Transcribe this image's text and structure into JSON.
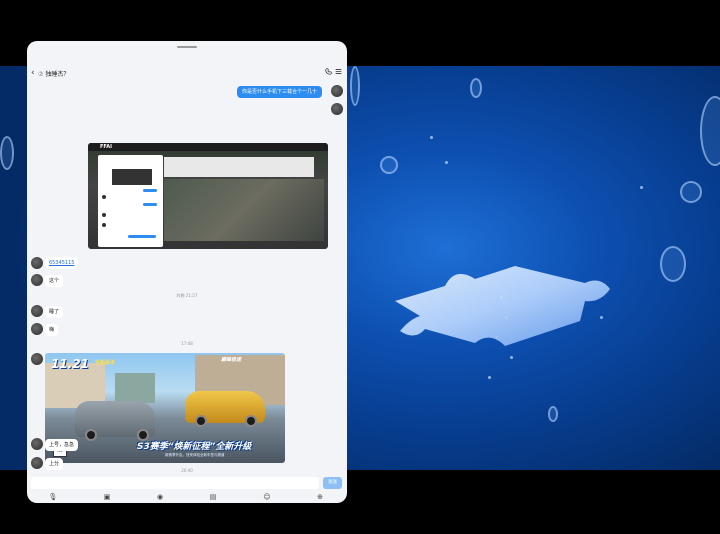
{
  "chat": {
    "title": "独睡杰？",
    "back_glyph": "‹",
    "header_tag": "⑦"
  },
  "icons": {
    "phone": "phone-icon",
    "menu": "menu-icon"
  },
  "messages": {
    "out_text": "你是否什么手机下三载合个一几十",
    "link_num": "65345115",
    "m_zhege": "这个",
    "time_1": "昨晚 21:57",
    "m_shuile": "睡了",
    "m_hai": "嗨",
    "time_2": "17:48",
    "time_3": "20:40",
    "m_shanghao": "上号，急急",
    "m_shangfen": "上分"
  },
  "game_banner": {
    "date": "11.21",
    "date_sub": "全新版本",
    "logo": "巅峰极速",
    "title": "S3赛季“焕新征程”全新升级",
    "sub": "新赛季开启，快来体验全新车型与赛道",
    "rating": "16+"
  },
  "screenshot_img": {
    "app_logo": "FFAI"
  },
  "composer": {
    "send_label": "发送"
  },
  "toolbar": {
    "mic": "🎙",
    "image": "▣",
    "camera": "◉",
    "file": "▤",
    "emoji": "☺",
    "plus": "⊕"
  },
  "colors": {
    "accent": "#2d8cf0",
    "panel_bg": "#f3f4f8"
  }
}
